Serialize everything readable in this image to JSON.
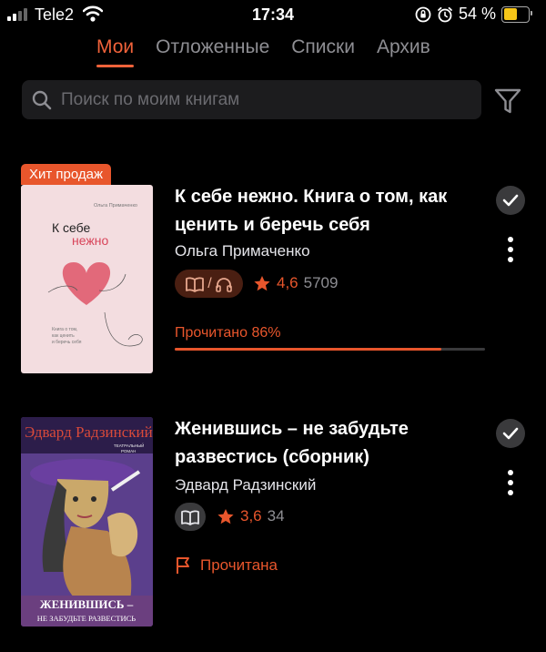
{
  "status_bar": {
    "carrier": "Tele2",
    "time": "17:34",
    "battery_text": "54 %",
    "battery_level": 0.54,
    "battery_color": "#f5c518"
  },
  "tabs": [
    {
      "label": "Мои",
      "active": true
    },
    {
      "label": "Отложенные",
      "active": false
    },
    {
      "label": "Списки",
      "active": false
    },
    {
      "label": "Архив",
      "active": false
    }
  ],
  "search": {
    "placeholder": "Поиск по моим книгам",
    "icon": "search-icon",
    "filter_icon": "filter-icon"
  },
  "accent_color": "#e8562c",
  "books": [
    {
      "badge": "Хит продаж",
      "title": "К себе нежно. Книга о том, как ценить и беречь себя",
      "author": "Ольга Примаченко",
      "format": "ebook+audiobook",
      "rating": "4,6",
      "rating_count": "5709",
      "progress_label": "Прочитано 86%",
      "progress": 0.86,
      "cover": {
        "author_line": "Ольга Примаченко",
        "title_line1": "К себе",
        "title_line2": "нежно",
        "subtitle1": "Книга о том,",
        "subtitle2": "как ценить",
        "subtitle3": "и беречь себя"
      }
    },
    {
      "title": "Женившись – не забудьте развестись (сборник)",
      "author": "Эдвард Радзинский",
      "format": "ebook",
      "rating": "3,6",
      "rating_count": "34",
      "status_label": "Прочитана",
      "cover": {
        "author_line": "Эдвард Радзинский",
        "genre1": "ТЕАТРАЛЬНЫЙ",
        "genre2": "РОМАН",
        "title_line1": "ЖЕНИВШИСЬ –",
        "title_line2": "НЕ ЗАБУДЬТЕ РАЗВЕСТИСЬ"
      }
    }
  ]
}
